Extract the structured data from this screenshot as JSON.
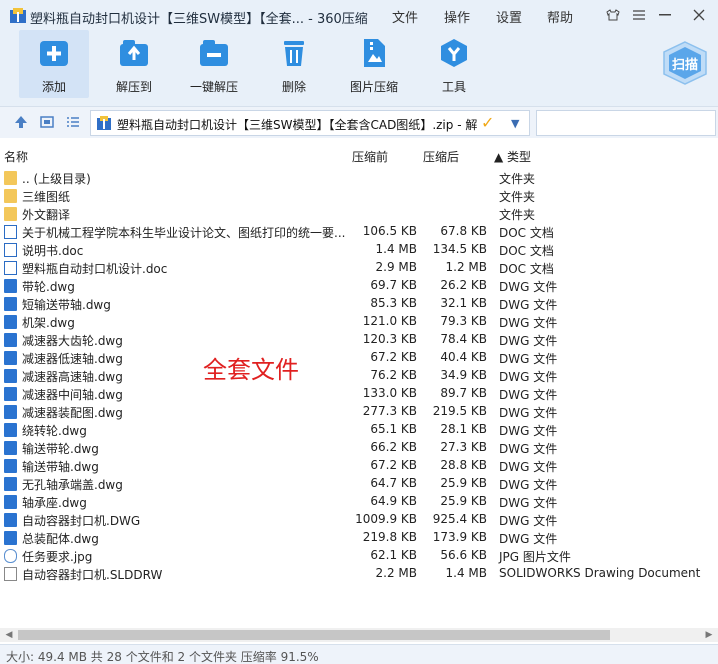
{
  "window": {
    "title": "塑料瓶自动封口机设计【三维SW模型】【全套... - 360压缩",
    "menus": [
      "文件",
      "操作",
      "设置",
      "帮助"
    ]
  },
  "toolbar": {
    "buttons": [
      {
        "label": "添加",
        "icon": "add-icon"
      },
      {
        "label": "解压到",
        "icon": "extract-icon"
      },
      {
        "label": "一键解压",
        "icon": "one-click-extract-icon"
      },
      {
        "label": "删除",
        "icon": "trash-icon"
      },
      {
        "label": "图片压缩",
        "icon": "image-compress-icon"
      },
      {
        "label": "工具",
        "icon": "tools-icon"
      }
    ],
    "scan_label": "扫描"
  },
  "address": {
    "path": "塑料瓶自动封口机设计【三维SW模型】【全套含CAD图纸】.zip - 解"
  },
  "columns": {
    "name": "名称",
    "compressed": "压缩前",
    "original": "压缩后",
    "type": "▲ 类型"
  },
  "files": [
    {
      "name": ".. (上级目录)",
      "csize": "",
      "osize": "",
      "type": "文件夹",
      "kind": "folder"
    },
    {
      "name": "三维图纸",
      "csize": "",
      "osize": "",
      "type": "文件夹",
      "kind": "folder"
    },
    {
      "name": "外文翻译",
      "csize": "",
      "osize": "",
      "type": "文件夹",
      "kind": "folder"
    },
    {
      "name": "关于机械工程学院本科生毕业设计论文、图纸打印的统一要...",
      "csize": "106.5 KB",
      "osize": "67.8 KB",
      "type": "DOC 文档",
      "kind": "doc"
    },
    {
      "name": "说明书.doc",
      "csize": "1.4 MB",
      "osize": "134.5 KB",
      "type": "DOC 文档",
      "kind": "doc"
    },
    {
      "name": "塑料瓶自动封口机设计.doc",
      "csize": "2.9 MB",
      "osize": "1.2 MB",
      "type": "DOC 文档",
      "kind": "doc"
    },
    {
      "name": "带轮.dwg",
      "csize": "69.7 KB",
      "osize": "26.2 KB",
      "type": "DWG 文件",
      "kind": "dwg"
    },
    {
      "name": "短输送带轴.dwg",
      "csize": "85.3 KB",
      "osize": "32.1 KB",
      "type": "DWG 文件",
      "kind": "dwg"
    },
    {
      "name": "机架.dwg",
      "csize": "121.0 KB",
      "osize": "79.3 KB",
      "type": "DWG 文件",
      "kind": "dwg"
    },
    {
      "name": "减速器大齿轮.dwg",
      "csize": "120.3 KB",
      "osize": "78.4 KB",
      "type": "DWG 文件",
      "kind": "dwg"
    },
    {
      "name": "减速器低速轴.dwg",
      "csize": "67.2 KB",
      "osize": "40.4 KB",
      "type": "DWG 文件",
      "kind": "dwg"
    },
    {
      "name": "减速器高速轴.dwg",
      "csize": "76.2 KB",
      "osize": "34.9 KB",
      "type": "DWG 文件",
      "kind": "dwg"
    },
    {
      "name": "减速器中间轴.dwg",
      "csize": "133.0 KB",
      "osize": "89.7 KB",
      "type": "DWG 文件",
      "kind": "dwg"
    },
    {
      "name": "减速器装配图.dwg",
      "csize": "277.3 KB",
      "osize": "219.5 KB",
      "type": "DWG 文件",
      "kind": "dwg"
    },
    {
      "name": "绕转轮.dwg",
      "csize": "65.1 KB",
      "osize": "28.1 KB",
      "type": "DWG 文件",
      "kind": "dwg"
    },
    {
      "name": "输送带轮.dwg",
      "csize": "66.2 KB",
      "osize": "27.3 KB",
      "type": "DWG 文件",
      "kind": "dwg"
    },
    {
      "name": "输送带轴.dwg",
      "csize": "67.2 KB",
      "osize": "28.8 KB",
      "type": "DWG 文件",
      "kind": "dwg"
    },
    {
      "name": "无孔轴承端盖.dwg",
      "csize": "64.7 KB",
      "osize": "25.9 KB",
      "type": "DWG 文件",
      "kind": "dwg"
    },
    {
      "name": "轴承座.dwg",
      "csize": "64.9 KB",
      "osize": "25.9 KB",
      "type": "DWG 文件",
      "kind": "dwg"
    },
    {
      "name": "自动容器封口机.DWG",
      "csize": "1009.9 KB",
      "osize": "925.4 KB",
      "type": "DWG 文件",
      "kind": "dwg"
    },
    {
      "name": "总装配体.dwg",
      "csize": "219.8 KB",
      "osize": "173.9 KB",
      "type": "DWG 文件",
      "kind": "dwg"
    },
    {
      "name": "任务要求.jpg",
      "csize": "62.1 KB",
      "osize": "56.6 KB",
      "type": "JPG 图片文件",
      "kind": "jpg"
    },
    {
      "name": "自动容器封口机.SLDDRW",
      "csize": "2.2 MB",
      "osize": "1.4 MB",
      "type": "SOLIDWORKS Drawing Document",
      "kind": "sld"
    }
  ],
  "overlay_text": "全套文件",
  "status": "大小: 49.4 MB 共 28 个文件和 2 个文件夹 压缩率 91.5%"
}
